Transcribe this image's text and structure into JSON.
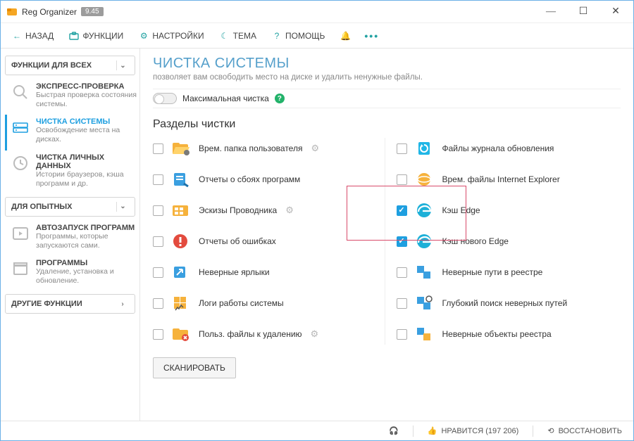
{
  "app": {
    "title": "Reg Organizer",
    "version": "9.45"
  },
  "window_controls": {
    "min": "—",
    "max": "☐",
    "close": "✕"
  },
  "toolbar": {
    "back": "НАЗАД",
    "functions": "ФУНКЦИИ",
    "settings": "НАСТРОЙКИ",
    "theme": "ТЕМА",
    "help": "ПОМОЩЬ"
  },
  "sidebar": {
    "group_all": "ФУНКЦИИ ДЛЯ ВСЕХ",
    "group_advanced": "ДЛЯ ОПЫТНЫХ",
    "group_other": "ДРУГИЕ ФУНКЦИИ",
    "items": [
      {
        "title": "ЭКСПРЕСС-ПРОВЕРКА",
        "desc": "Быстрая проверка состояния системы."
      },
      {
        "title": "ЧИСТКА СИСТЕМЫ",
        "desc": "Освобождение места на дисках."
      },
      {
        "title": "ЧИСТКА ЛИЧНЫХ ДАННЫХ",
        "desc": "Истории браузеров, кэша программ и др."
      },
      {
        "title": "АВТОЗАПУСК ПРОГРАММ",
        "desc": "Программы, которые запускаются сами."
      },
      {
        "title": "ПРОГРАММЫ",
        "desc": "Удаление, установка и обновление."
      }
    ]
  },
  "page": {
    "title": "ЧИСТКА СИСТЕМЫ",
    "subtitle": "позволяет вам освободить место на диске и удалить ненужные файлы.",
    "max_clean": "Максимальная чистка",
    "section": "Разделы чистки"
  },
  "items_left": [
    {
      "label": "Врем. папка пользователя",
      "gear": true
    },
    {
      "label": "Отчеты о сбоях программ"
    },
    {
      "label": "Эскизы Проводника",
      "gear": true
    },
    {
      "label": "Отчеты об ошибках"
    },
    {
      "label": "Неверные ярлыки"
    },
    {
      "label": "Логи работы системы"
    },
    {
      "label": "Польз. файлы к удалению",
      "gear": true
    }
  ],
  "items_right": [
    {
      "label": "Файлы журнала обновления"
    },
    {
      "label": "Врем. файлы Internet Explorer"
    },
    {
      "label": "Кэш Edge",
      "checked": true
    },
    {
      "label": "Кэш нового Edge",
      "checked": true
    },
    {
      "label": "Неверные пути в реестре"
    },
    {
      "label": "Глубокий поиск неверных путей"
    },
    {
      "label": "Неверные объекты реестра"
    }
  ],
  "scan_button": "СКАНИРОВАТЬ",
  "status": {
    "like": "НРАВИТСЯ (197 206)",
    "restore": "ВОССТАНОВИТЬ"
  }
}
